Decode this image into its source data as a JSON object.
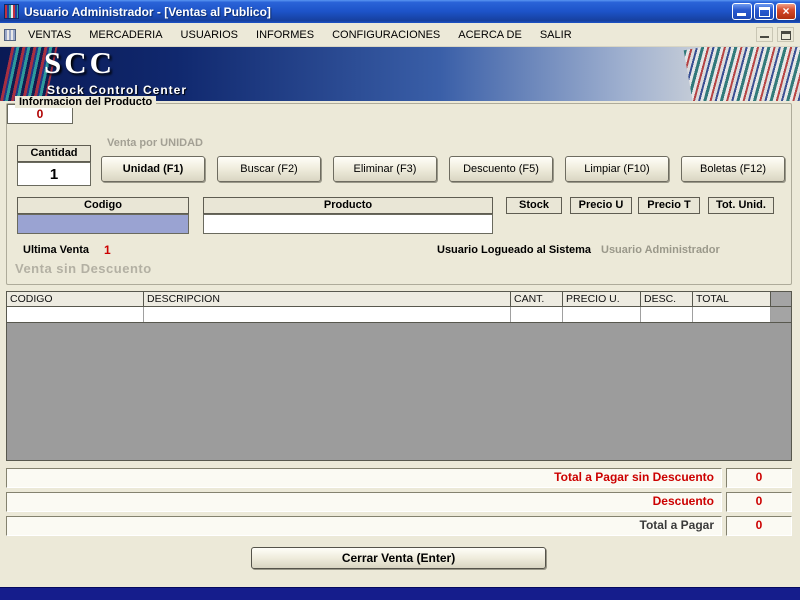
{
  "colors": {
    "accent_red": "#cc0000",
    "codigo_field_bg": "#9aa3d2",
    "titlebar_blue": "#1d53c8",
    "footer_navy": "#151d8c",
    "table_body_gray": "#9c9c9c"
  },
  "window": {
    "title": "Usuario Administrador - [Ventas al Publico]",
    "close_glyph": "×"
  },
  "menu": {
    "items": [
      "VENTAS",
      "MERCADERIA",
      "USUARIOS",
      "INFORMES",
      "CONFIGURACIONES",
      "ACERCA DE",
      "SALIR"
    ]
  },
  "banner": {
    "logo": "SCC",
    "subtitle": "Stock Control Center"
  },
  "product_info": {
    "group_title": "Informacion del Producto",
    "cantidad_label": "Cantidad",
    "cantidad_value": "1",
    "venta_mode_label": "Venta por UNIDAD",
    "buttons": [
      "Unidad (F1)",
      "Buscar (F2)",
      "Eliminar (F3)",
      "Descuento (F5)",
      "Limpiar (F10)",
      "Boletas (F12)"
    ],
    "field_headers": [
      "Codigo",
      "Producto",
      "Stock",
      "Precio U",
      "Precio T",
      "Tot. Unid."
    ],
    "codigo_value": "",
    "producto_value": "",
    "tot_unid_value": "0",
    "ultima_venta_label": "Ultima Venta",
    "ultima_venta_value": "1",
    "usuario_logueado_label": "Usuario Logueado al Sistema",
    "usuario_logueado_value": "Usuario Administrador",
    "venta_sin_descuento_label": "Venta sin Descuento"
  },
  "sales_table": {
    "headers": [
      "CODIGO",
      "DESCRIPCION",
      "CANT.",
      "PRECIO U.",
      "DESC.",
      "TOTAL"
    ],
    "rows": []
  },
  "totals": [
    {
      "label": "Total a Pagar sin Descuento",
      "value": "0"
    },
    {
      "label": "Descuento",
      "value": "0"
    },
    {
      "label": "Total a Pagar",
      "value": "0"
    }
  ],
  "footer": {
    "close_sale_button": "Cerrar Venta (Enter)"
  }
}
